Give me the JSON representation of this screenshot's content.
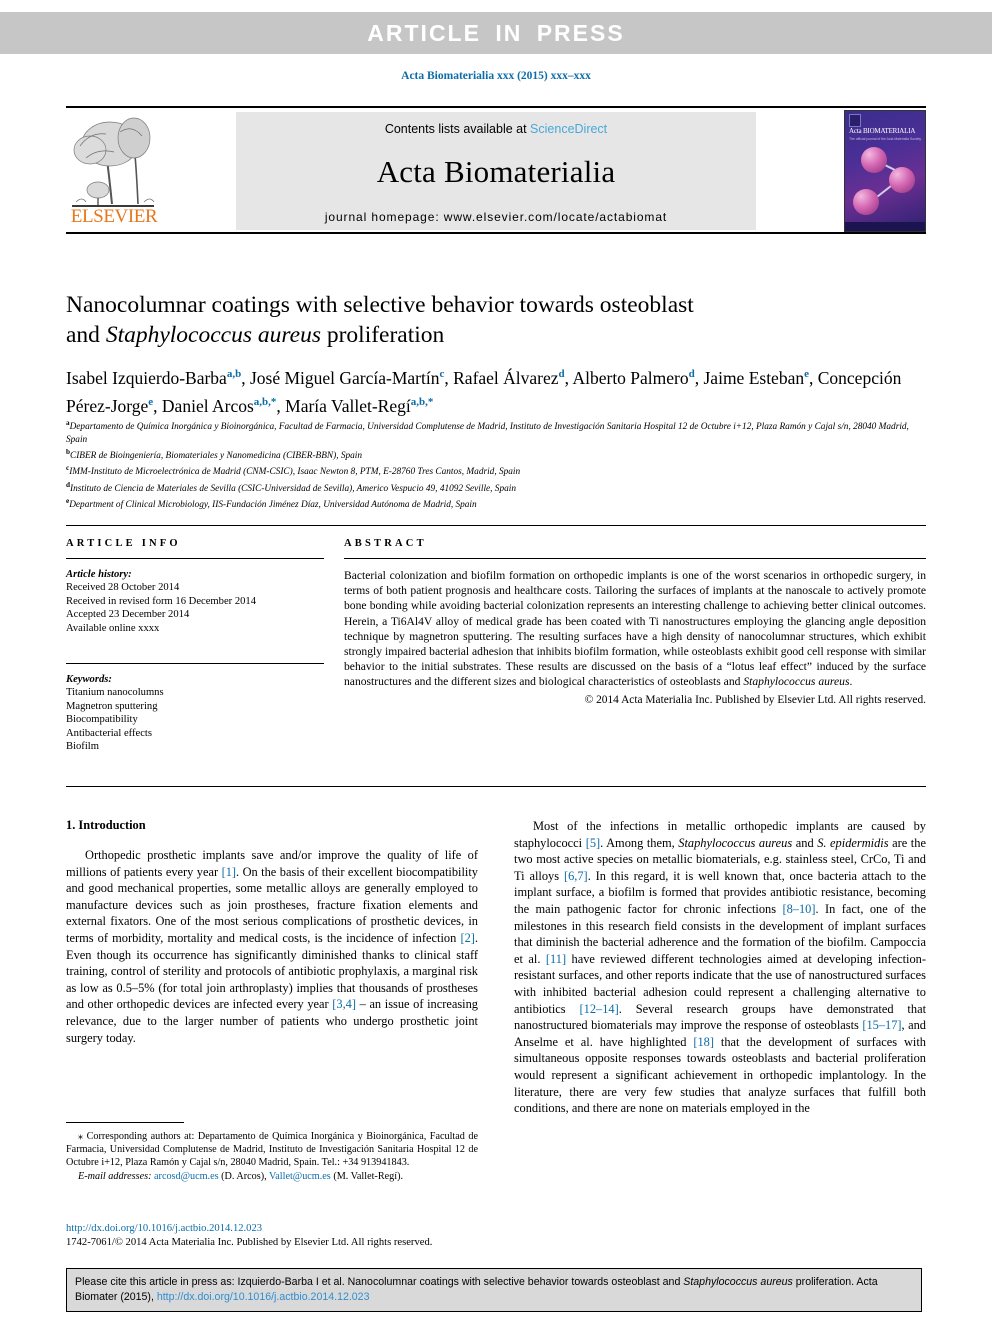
{
  "banner": {
    "text": "ARTICLE IN PRESS"
  },
  "running_head": "Acta Biomaterialia xxx (2015) xxx–xxx",
  "masthead": {
    "contents_prefix": "Contents lists available at ",
    "sciencedirect": "ScienceDirect",
    "journal_title": "Acta Biomaterialia",
    "homepage": "journal homepage: www.elsevier.com/locate/actabiomat",
    "publisher_logo_text": "ELSEVIER",
    "cover": {
      "title": "Acta BIOMATERIALIA",
      "subtitle": "The official journal of the Acta Materialia Society"
    }
  },
  "title": {
    "line1": "Nanocolumnar coatings with selective behavior towards osteoblast",
    "line2_prefix": "and ",
    "line2_italic": "Staphylococcus aureus",
    "line2_suffix": " proliferation"
  },
  "authors": [
    {
      "name": "Isabel Izquierdo-Barba",
      "sup": "a,b"
    },
    {
      "name": "José Miguel García-Martín",
      "sup": "c"
    },
    {
      "name": "Rafael Álvarez",
      "sup": "d"
    },
    {
      "name": "Alberto Palmero",
      "sup": "d"
    },
    {
      "name": "Jaime Esteban",
      "sup": "e"
    },
    {
      "name": "Concepción Pérez-Jorge",
      "sup": "e"
    },
    {
      "name": "Daniel Arcos",
      "sup": "a,b,*"
    },
    {
      "name": "María Vallet-Regí",
      "sup": "a,b,*"
    }
  ],
  "affiliations": [
    {
      "mark": "a",
      "text": "Departamento de Química Inorgánica y Bioinorgánica, Facultad de Farmacia, Universidad Complutense de Madrid, Instituto de Investigación Sanitaria Hospital 12 de Octubre i+12, Plaza Ramón y Cajal s/n, 28040 Madrid, Spain"
    },
    {
      "mark": "b",
      "text": "CIBER de Bioingeniería, Biomateriales y Nanomedicina (CIBER-BBN), Spain"
    },
    {
      "mark": "c",
      "text": "IMM-Instituto de Microelectrónica de Madrid (CNM-CSIC), Isaac Newton 8, PTM, E-28760 Tres Cantos, Madrid, Spain"
    },
    {
      "mark": "d",
      "text": "Instituto de Ciencia de Materiales de Sevilla (CSIC-Universidad de Sevilla), Americo Vespucio 49, 41092 Seville, Spain"
    },
    {
      "mark": "e",
      "text": "Department of Clinical Microbiology, IIS-Fundación Jiménez Díaz, Universidad Autónoma de Madrid, Spain"
    }
  ],
  "article_info": {
    "heading": "ARTICLE INFO",
    "history_label": "Article history:",
    "history": [
      "Received 28 October 2014",
      "Received in revised form 16 December 2014",
      "Accepted 23 December 2014",
      "Available online xxxx"
    ],
    "keywords_label": "Keywords:",
    "keywords": [
      "Titanium nanocolumns",
      "Magnetron sputtering",
      "Biocompatibility",
      "Antibacterial effects",
      "Biofilm"
    ]
  },
  "abstract": {
    "heading": "ABSTRACT",
    "part1": "Bacterial colonization and biofilm formation on orthopedic implants is one of the worst scenarios in orthopedic surgery, in terms of both patient prognosis and healthcare costs. Tailoring the surfaces of implants at the nanoscale to actively promote bone bonding while avoiding bacterial colonization represents an interesting challenge to achieving better clinical outcomes. Herein, a Ti6Al4V alloy of medical grade has been coated with Ti nanostructures employing the glancing angle deposition technique by magnetron sputtering. The resulting surfaces have a high density of nanocolumnar structures, which exhibit strongly impaired bacterial adhesion that inhibits biofilm formation, while osteoblasts exhibit good cell response with similar behavior to the initial substrates. These results are discussed on the basis of a “lotus leaf effect” induced by the surface nanostructures and the different sizes and biological characteristics of osteoblasts and ",
    "italic_species": "Staphylococcus aureus",
    "part2": ".",
    "copyright": "© 2014 Acta Materialia Inc. Published by Elsevier Ltd. All rights reserved."
  },
  "introduction": {
    "heading": "1. Introduction",
    "left_p1_a": "Orthopedic prosthetic implants save and/or improve the quality of life of millions of patients every year ",
    "left_ref1": "[1]",
    "left_p1_b": ". On the basis of their excellent biocompatibility and good mechanical properties, some metallic alloys are generally employed to manufacture devices such as join prostheses, fracture fixation elements and external fixators. One of the most serious complications of prosthetic devices, in terms of morbidity, mortality and medical costs, is the incidence of infection ",
    "left_ref2": "[2]",
    "left_p1_c": ". Even though its occurrence has significantly diminished thanks to clinical staff training, control of sterility and protocols of antibiotic prophylaxis, a marginal risk as low as 0.5–5% (for total join arthroplasty) implies that thousands of prostheses and other orthopedic devices are infected every year ",
    "left_ref3": "[3,4]",
    "left_p1_d": " – an issue of increasing relevance, due to the larger number of patients who undergo prosthetic joint surgery today.",
    "right_a": "Most of the infections in metallic orthopedic implants are caused by staphylococci ",
    "right_ref5": "[5]",
    "right_b": ". Among them, ",
    "right_it1": "Staphylococcus aureus",
    "right_c": " and ",
    "right_it2": "S. epidermidis",
    "right_d": " are the two most active species on metallic biomaterials, e.g. stainless steel, CrCo, Ti and Ti alloys ",
    "right_ref67": "[6,7]",
    "right_e": ". In this regard, it is well known that, once bacteria attach to the implant surface, a biofilm is formed that provides antibiotic resistance, becoming the main pathogenic factor for chronic infections ",
    "right_ref810": "[8–10]",
    "right_f": ". In fact, one of the milestones in this research field consists in the development of implant surfaces that diminish the bacterial adherence and the formation of the biofilm. Campoccia et al. ",
    "right_ref11": "[11]",
    "right_g": " have reviewed different technologies aimed at developing infection-resistant surfaces, and other reports indicate that the use of nanostructured surfaces with inhibited bacterial adhesion could represent a challenging alternative to antibiotics ",
    "right_ref1214": "[12–14]",
    "right_h": ". Several research groups have demonstrated that nanostructured biomaterials may improve the response of osteoblasts ",
    "right_ref1517": "[15–17]",
    "right_i": ", and Anselme et al. have highlighted ",
    "right_ref18": "[18]",
    "right_j": " that the development of surfaces with simultaneous opposite responses towards osteoblasts and bacterial proliferation would represent a significant achievement in orthopedic implantology. In the literature, there are very few studies that analyze surfaces that fulfill both conditions, and there are none on materials employed in the"
  },
  "footnote": {
    "corresponding": "⁎ Corresponding authors at: Departamento de Química Inorgánica y Bioinorgánica, Facultad de Farmacia, Universidad Complutense de Madrid, Instituto de Investigación Sanitaria Hospital 12 de Octubre i+12, Plaza Ramón y Cajal s/n, 28040 Madrid, Spain. Tel.: +34 913941843.",
    "email_label": "E-mail addresses:",
    "email1": "arcosd@ucm.es",
    "email1_owner": " (D. Arcos), ",
    "email2": "Vallet@ucm.es",
    "email2_owner": " (M. Vallet-Regí)."
  },
  "doi_block": {
    "doi_url": "http://dx.doi.org/10.1016/j.actbio.2014.12.023",
    "issn_line": "1742-7061/© 2014 Acta Materialia Inc. Published by Elsevier Ltd. All rights reserved."
  },
  "cite_box": {
    "prefix": "Please cite this article in press as: Izquierdo-Barba I et al. Nanocolumnar coatings with selective behavior towards osteoblast and ",
    "italic": "Staphylococcus aureus",
    "middle": " proliferation. Acta Biomater (2015), ",
    "link": "http://dx.doi.org/10.1016/j.actbio.2014.12.023"
  },
  "colors": {
    "link_blue": "#0b6ca8",
    "banner_gray": "#c6c6c6",
    "panel_gray": "#e6e6e6",
    "elsevier_orange": "#e8761a",
    "cite_gray": "#d9d9d9"
  }
}
